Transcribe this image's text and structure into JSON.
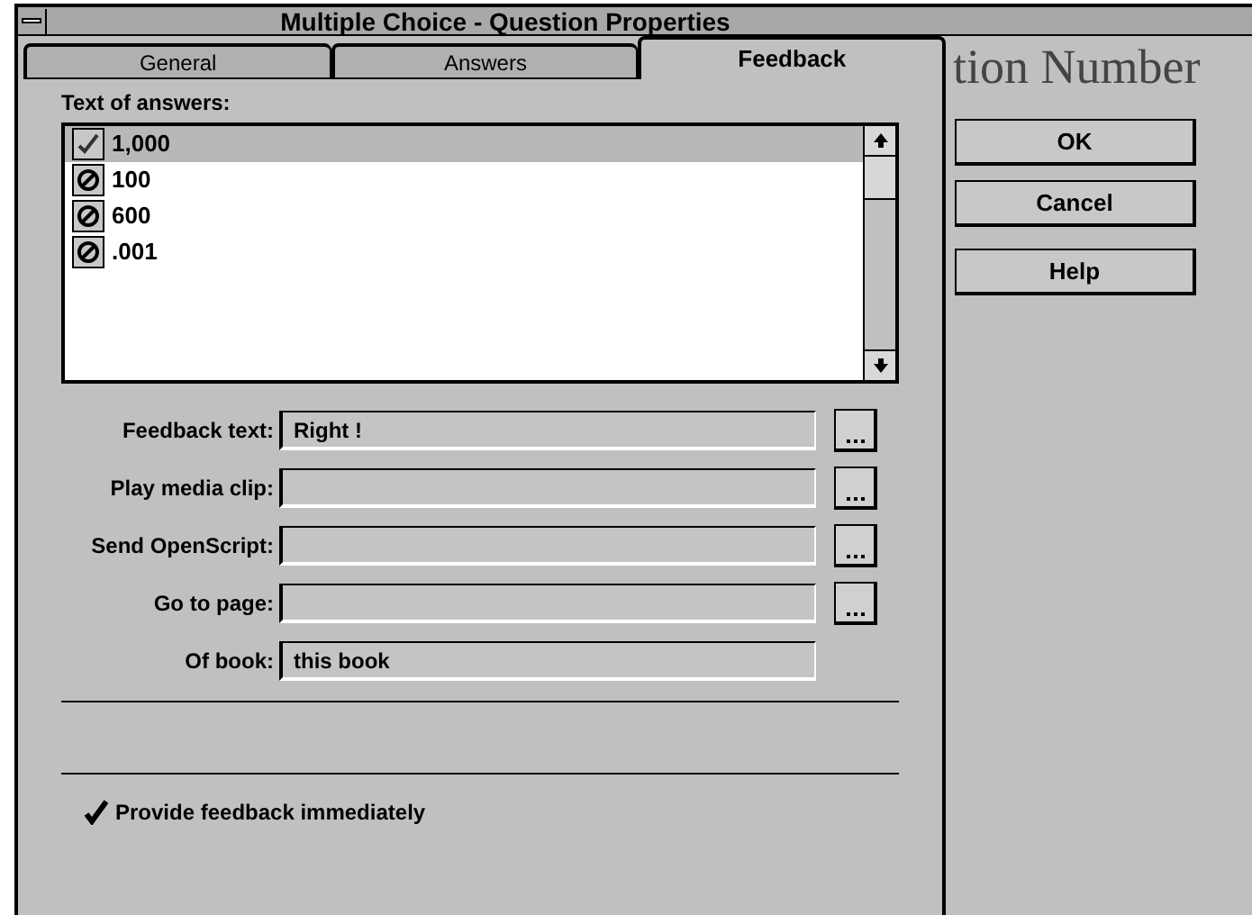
{
  "window": {
    "title": "Multiple Choice - Question Properties"
  },
  "background_text": "tion Number",
  "tabs": [
    {
      "label": "General",
      "selected": false
    },
    {
      "label": "Answers",
      "selected": false
    },
    {
      "label": "Feedback",
      "selected": true
    }
  ],
  "answers_label": "Text of answers:",
  "answers": [
    {
      "text": "1,000",
      "correct": true,
      "selected": true
    },
    {
      "text": "100",
      "correct": false,
      "selected": false
    },
    {
      "text": "600",
      "correct": false,
      "selected": false
    },
    {
      "text": ".001",
      "correct": false,
      "selected": false
    }
  ],
  "fields": [
    {
      "label": "Feedback text:",
      "value": "Right !",
      "browse": true
    },
    {
      "label": "Play media clip:",
      "browse": true
    },
    {
      "label": "Send OpenScript:",
      "browse": true
    },
    {
      "label": "Go to page:",
      "browse": true
    },
    {
      "label": "Of book:",
      "value": "this book",
      "browse": false
    }
  ],
  "provide_feedback": {
    "label": "Provide feedback immediately",
    "checked": true
  },
  "buttons": [
    "OK",
    "Cancel",
    "Help"
  ]
}
